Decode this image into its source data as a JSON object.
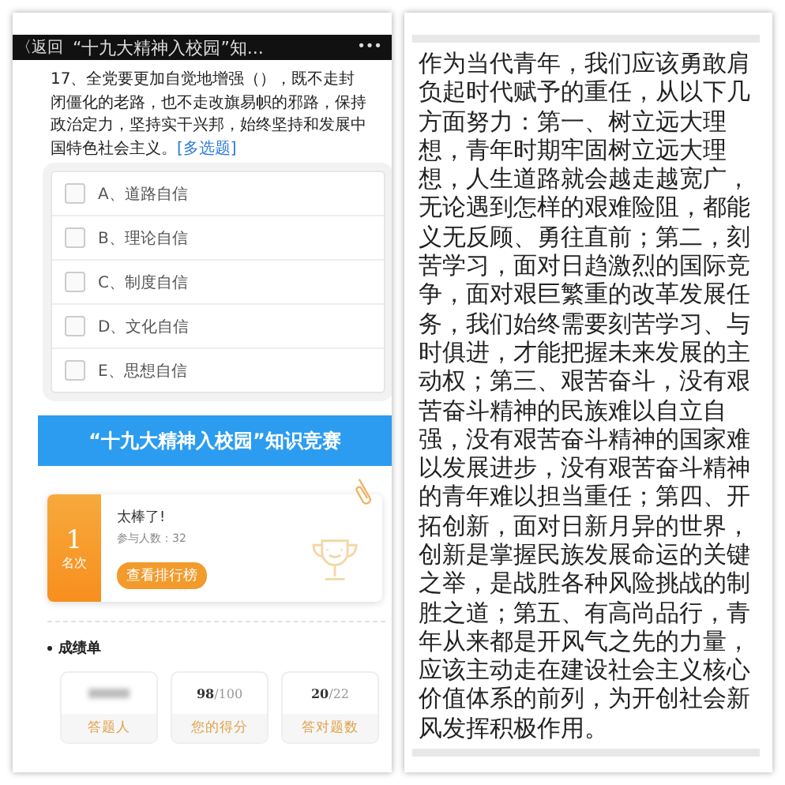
{
  "phone": {
    "nav": {
      "back": "〈返回",
      "title": "“十九大精神入校园”知...",
      "more": "•••"
    },
    "question": {
      "text": "17、全党要更加自觉地增强（），既不走封闭僵化的老路，也不走改旗易帜的邪路，保持政治定力，坚持实干兴邦，始终坚持和发展中国特色社会主义。",
      "tag": "[多选题]"
    },
    "options": [
      {
        "label": "A、道路自信",
        "checked": false
      },
      {
        "label": "B、理论自信",
        "checked": false
      },
      {
        "label": "C、制度自信",
        "checked": false
      },
      {
        "label": "D、文化自信",
        "checked": false
      },
      {
        "label": "E、思想自信",
        "checked": false
      }
    ],
    "banner": "“十九大精神入校园”知识竞赛",
    "result": {
      "rank": "1",
      "rank_label": "名次",
      "title": "太棒了!",
      "participants": "参与人数：32",
      "button": "查看排行榜"
    },
    "scores": {
      "heading": "成绩单",
      "items": [
        {
          "kind": "hidden",
          "label": "答题人"
        },
        {
          "kind": "score",
          "value": "98",
          "total": "/100",
          "label": "您的得分"
        },
        {
          "kind": "score",
          "value": "20",
          "total": "/22",
          "label": "答对题数"
        }
      ]
    }
  },
  "essay": {
    "text": "作为当代青年，我们应该勇敢肩负起时代赋予的重任，从以下几方面努力：第一、树立远大理想，青年时期牢固树立远大理想，人生道路就会越走越宽广，无论遇到怎样的艰难险阻，都能义无反顾、勇往直前；第二，刻苦学习，面对日趋激烈的国际竞争，面对艰巨繁重的改革发展任务，我们始终需要刻苦学习、与时俱进，才能把握未来发展的主动权；第三、艰苦奋斗，没有艰苦奋斗精神的民族难以自立自强，没有艰苦奋斗精神的国家难以发展进步，没有艰苦奋斗精神的青年难以担当重任；第四、开拓创新，面对日新月异的世界，创新是掌握民族发展命运的关键之举，是战胜各种风险挑战的制胜之道；第五、有高尚品行，青年从来都是开风气之先的力量，应该主动走在建设社会主义核心价值体系的前列，为开创社会新风发挥积极作用。"
  }
}
